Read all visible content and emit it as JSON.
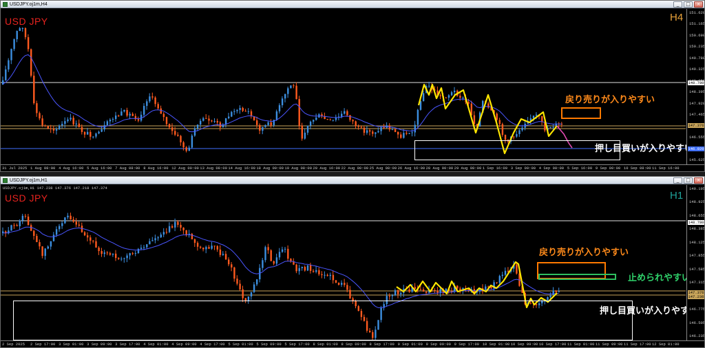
{
  "colors": {
    "background": "#000000",
    "bull": "#3c8fe0",
    "bear": "#ff5a1f",
    "ma": "#4a56ff",
    "zigzag": "#ffe600",
    "forecast": "#e04ab0",
    "symbol": "#e8231f",
    "level_gold": "#c8a45a",
    "level_white": "#e0e0e0",
    "level_blue": "#3f6fff",
    "sell_box": "#ff7a00",
    "support_box": "#ffffff",
    "stop_box": "#2fbf5f"
  },
  "top": {
    "title": "USDJPY.oj1m,H4",
    "symbol": "USD JPY",
    "timeframe": "H4",
    "window_buttons": [
      "_",
      "□",
      "×"
    ],
    "price_labels": [
      "151.620",
      "151.165",
      "150.690",
      "150.235",
      "149.780",
      "149.325",
      "148.850",
      "148.395",
      "147.920",
      "147.465",
      "147.010",
      "146.555",
      "146.080",
      "145.625"
    ],
    "price_tags": [
      {
        "text": "148.780",
        "kind": "white"
      },
      {
        "text": "147.376",
        "kind": "gold"
      },
      {
        "text": "146.920",
        "kind": "blue"
      }
    ],
    "time_labels": [
      "31 Jul 2025",
      "1 Aug 08:00",
      "4 Aug 16:00",
      "5 Aug 16:00",
      "7 Aug 08:00",
      "8 Aug 16:00",
      "12 Aug 00:00",
      "13 Aug 08:00",
      "14 Aug 16:00",
      "18 Aug 00:00",
      "19 Aug 08:00",
      "20 Aug 16:00",
      "22 Aug 00:00",
      "25 Aug 08:00",
      "26 Aug 16:00",
      "28 Aug 00:00",
      "29 Aug 08:00",
      "1 Sep 16:00",
      "3 Sep 00:00",
      "4 Sep 08:00",
      "5 Sep 16:00",
      "9 Sep 00:00",
      "10 Sep 08:00",
      "11 Sep 16:00"
    ],
    "annotation_sell": "戻り売りが入りやすい",
    "annotation_support": "押し目買いが入りやすい"
  },
  "bottom": {
    "title": "USDJPY.oj1m,H1",
    "ohlc_text": "USDJPY.oj1m,H1  147.238 147.376 147.218 147.374",
    "symbol": "USD JPY",
    "timeframe": "H1",
    "window_buttons": [
      "_",
      "□",
      "×"
    ],
    "price_labels": [
      "149.195",
      "148.925",
      "148.655",
      "148.385",
      "148.125",
      "147.855",
      "147.585",
      "147.315",
      "147.045",
      "146.775",
      "146.505",
      "146.235"
    ],
    "price_tags": [
      {
        "text": "148.780",
        "kind": "white"
      },
      {
        "text": "147.376",
        "kind": "gold"
      },
      {
        "text": "147.236",
        "kind": "gold"
      }
    ],
    "time_labels": [
      "2 Sep 2025",
      "2 Sep 17:00",
      "3 Sep 01:00",
      "3 Sep 09:00",
      "3 Sep 17:00",
      "4 Sep 01:00",
      "4 Sep 09:00",
      "4 Sep 17:00",
      "5 Sep 01:00",
      "5 Sep 09:00",
      "5 Sep 17:00",
      "8 Sep 01:00",
      "8 Sep 09:00",
      "8 Sep 17:00",
      "9 Sep 01:00",
      "9 Sep 09:00",
      "9 Sep 17:00",
      "10 Sep 01:00",
      "10 Sep 09:00",
      "10 Sep 17:00",
      "11 Sep 01:00",
      "11 Sep 09:00",
      "11 Sep 17:00",
      "12 Sep 01:00"
    ],
    "annotation_sell": "戻り売りが入りやすい",
    "annotation_stop": "止められやすい",
    "annotation_support": "押し目買いが入りやすい"
  }
}
